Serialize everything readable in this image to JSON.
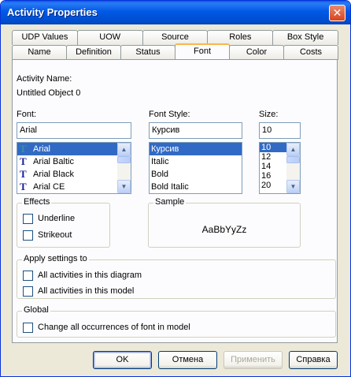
{
  "window": {
    "title": "Activity Properties",
    "close_glyph": "✕"
  },
  "tabs": {
    "row_back": [
      "UDP Values",
      "UOW",
      "Source",
      "Roles",
      "Box Style"
    ],
    "row_front": [
      "Name",
      "Definition",
      "Status",
      "Font",
      "Color",
      "Costs"
    ],
    "active": "Font"
  },
  "activity": {
    "name_label": "Activity Name:",
    "name_value": "Untitled Object 0"
  },
  "font": {
    "label": "Font:",
    "value": "Arial",
    "items": [
      "Arial",
      "Arial Baltic",
      "Arial Black",
      "Arial CE"
    ]
  },
  "font_style": {
    "label": "Font Style:",
    "value": "Курсив",
    "items": [
      "Курсив",
      "Italic",
      "Bold",
      "Bold Italic"
    ]
  },
  "size": {
    "label": "Size:",
    "value": "10",
    "items": [
      "10",
      "12",
      "14",
      "16",
      "20"
    ]
  },
  "effects": {
    "label": "Effects",
    "underline": "Underline",
    "strikeout": "Strikeout"
  },
  "sample": {
    "label": "Sample",
    "text": "AaBbYyZz"
  },
  "apply": {
    "label": "Apply settings to",
    "diagram": "All activities in this diagram",
    "model": "All activities in this model"
  },
  "global": {
    "label": "Global",
    "change_all": "Change all occurrences of font in model"
  },
  "buttons": {
    "ok": "OK",
    "cancel": "Отмена",
    "apply": "Применить",
    "help": "Справка"
  }
}
